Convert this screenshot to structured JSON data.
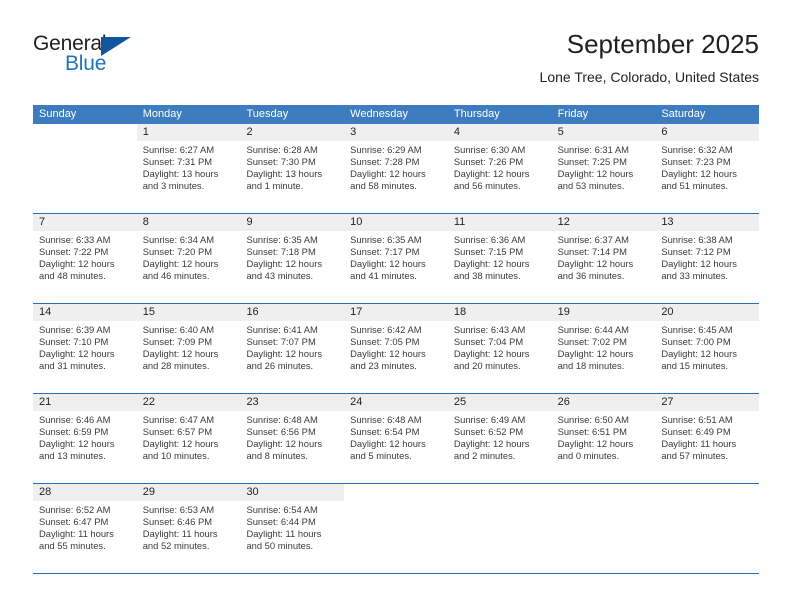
{
  "brand": {
    "word1": "General",
    "word2": "Blue",
    "logo_icon": "triangle-logo-icon",
    "accent_color": "#1f72bd"
  },
  "header": {
    "title": "September 2025",
    "location": "Lone Tree, Colorado, United States"
  },
  "calendar": {
    "header_bg": "#3c7cbf",
    "row_divider_color": "#2a6db0",
    "daynum_band_bg": "#efefef",
    "weekdays": [
      "Sunday",
      "Monday",
      "Tuesday",
      "Wednesday",
      "Thursday",
      "Friday",
      "Saturday"
    ],
    "weeks": [
      [
        {
          "day": "",
          "lines": []
        },
        {
          "day": "1",
          "lines": [
            "Sunrise: 6:27 AM",
            "Sunset: 7:31 PM",
            "Daylight: 13 hours",
            "and 3 minutes."
          ]
        },
        {
          "day": "2",
          "lines": [
            "Sunrise: 6:28 AM",
            "Sunset: 7:30 PM",
            "Daylight: 13 hours",
            "and 1 minute."
          ]
        },
        {
          "day": "3",
          "lines": [
            "Sunrise: 6:29 AM",
            "Sunset: 7:28 PM",
            "Daylight: 12 hours",
            "and 58 minutes."
          ]
        },
        {
          "day": "4",
          "lines": [
            "Sunrise: 6:30 AM",
            "Sunset: 7:26 PM",
            "Daylight: 12 hours",
            "and 56 minutes."
          ]
        },
        {
          "day": "5",
          "lines": [
            "Sunrise: 6:31 AM",
            "Sunset: 7:25 PM",
            "Daylight: 12 hours",
            "and 53 minutes."
          ]
        },
        {
          "day": "6",
          "lines": [
            "Sunrise: 6:32 AM",
            "Sunset: 7:23 PM",
            "Daylight: 12 hours",
            "and 51 minutes."
          ]
        }
      ],
      [
        {
          "day": "7",
          "lines": [
            "Sunrise: 6:33 AM",
            "Sunset: 7:22 PM",
            "Daylight: 12 hours",
            "and 48 minutes."
          ]
        },
        {
          "day": "8",
          "lines": [
            "Sunrise: 6:34 AM",
            "Sunset: 7:20 PM",
            "Daylight: 12 hours",
            "and 46 minutes."
          ]
        },
        {
          "day": "9",
          "lines": [
            "Sunrise: 6:35 AM",
            "Sunset: 7:18 PM",
            "Daylight: 12 hours",
            "and 43 minutes."
          ]
        },
        {
          "day": "10",
          "lines": [
            "Sunrise: 6:35 AM",
            "Sunset: 7:17 PM",
            "Daylight: 12 hours",
            "and 41 minutes."
          ]
        },
        {
          "day": "11",
          "lines": [
            "Sunrise: 6:36 AM",
            "Sunset: 7:15 PM",
            "Daylight: 12 hours",
            "and 38 minutes."
          ]
        },
        {
          "day": "12",
          "lines": [
            "Sunrise: 6:37 AM",
            "Sunset: 7:14 PM",
            "Daylight: 12 hours",
            "and 36 minutes."
          ]
        },
        {
          "day": "13",
          "lines": [
            "Sunrise: 6:38 AM",
            "Sunset: 7:12 PM",
            "Daylight: 12 hours",
            "and 33 minutes."
          ]
        }
      ],
      [
        {
          "day": "14",
          "lines": [
            "Sunrise: 6:39 AM",
            "Sunset: 7:10 PM",
            "Daylight: 12 hours",
            "and 31 minutes."
          ]
        },
        {
          "day": "15",
          "lines": [
            "Sunrise: 6:40 AM",
            "Sunset: 7:09 PM",
            "Daylight: 12 hours",
            "and 28 minutes."
          ]
        },
        {
          "day": "16",
          "lines": [
            "Sunrise: 6:41 AM",
            "Sunset: 7:07 PM",
            "Daylight: 12 hours",
            "and 26 minutes."
          ]
        },
        {
          "day": "17",
          "lines": [
            "Sunrise: 6:42 AM",
            "Sunset: 7:05 PM",
            "Daylight: 12 hours",
            "and 23 minutes."
          ]
        },
        {
          "day": "18",
          "lines": [
            "Sunrise: 6:43 AM",
            "Sunset: 7:04 PM",
            "Daylight: 12 hours",
            "and 20 minutes."
          ]
        },
        {
          "day": "19",
          "lines": [
            "Sunrise: 6:44 AM",
            "Sunset: 7:02 PM",
            "Daylight: 12 hours",
            "and 18 minutes."
          ]
        },
        {
          "day": "20",
          "lines": [
            "Sunrise: 6:45 AM",
            "Sunset: 7:00 PM",
            "Daylight: 12 hours",
            "and 15 minutes."
          ]
        }
      ],
      [
        {
          "day": "21",
          "lines": [
            "Sunrise: 6:46 AM",
            "Sunset: 6:59 PM",
            "Daylight: 12 hours",
            "and 13 minutes."
          ]
        },
        {
          "day": "22",
          "lines": [
            "Sunrise: 6:47 AM",
            "Sunset: 6:57 PM",
            "Daylight: 12 hours",
            "and 10 minutes."
          ]
        },
        {
          "day": "23",
          "lines": [
            "Sunrise: 6:48 AM",
            "Sunset: 6:56 PM",
            "Daylight: 12 hours",
            "and 8 minutes."
          ]
        },
        {
          "day": "24",
          "lines": [
            "Sunrise: 6:48 AM",
            "Sunset: 6:54 PM",
            "Daylight: 12 hours",
            "and 5 minutes."
          ]
        },
        {
          "day": "25",
          "lines": [
            "Sunrise: 6:49 AM",
            "Sunset: 6:52 PM",
            "Daylight: 12 hours",
            "and 2 minutes."
          ]
        },
        {
          "day": "26",
          "lines": [
            "Sunrise: 6:50 AM",
            "Sunset: 6:51 PM",
            "Daylight: 12 hours",
            "and 0 minutes."
          ]
        },
        {
          "day": "27",
          "lines": [
            "Sunrise: 6:51 AM",
            "Sunset: 6:49 PM",
            "Daylight: 11 hours",
            "and 57 minutes."
          ]
        }
      ],
      [
        {
          "day": "28",
          "lines": [
            "Sunrise: 6:52 AM",
            "Sunset: 6:47 PM",
            "Daylight: 11 hours",
            "and 55 minutes."
          ]
        },
        {
          "day": "29",
          "lines": [
            "Sunrise: 6:53 AM",
            "Sunset: 6:46 PM",
            "Daylight: 11 hours",
            "and 52 minutes."
          ]
        },
        {
          "day": "30",
          "lines": [
            "Sunrise: 6:54 AM",
            "Sunset: 6:44 PM",
            "Daylight: 11 hours",
            "and 50 minutes."
          ]
        },
        {
          "day": "",
          "lines": []
        },
        {
          "day": "",
          "lines": []
        },
        {
          "day": "",
          "lines": []
        },
        {
          "day": "",
          "lines": []
        }
      ]
    ]
  }
}
